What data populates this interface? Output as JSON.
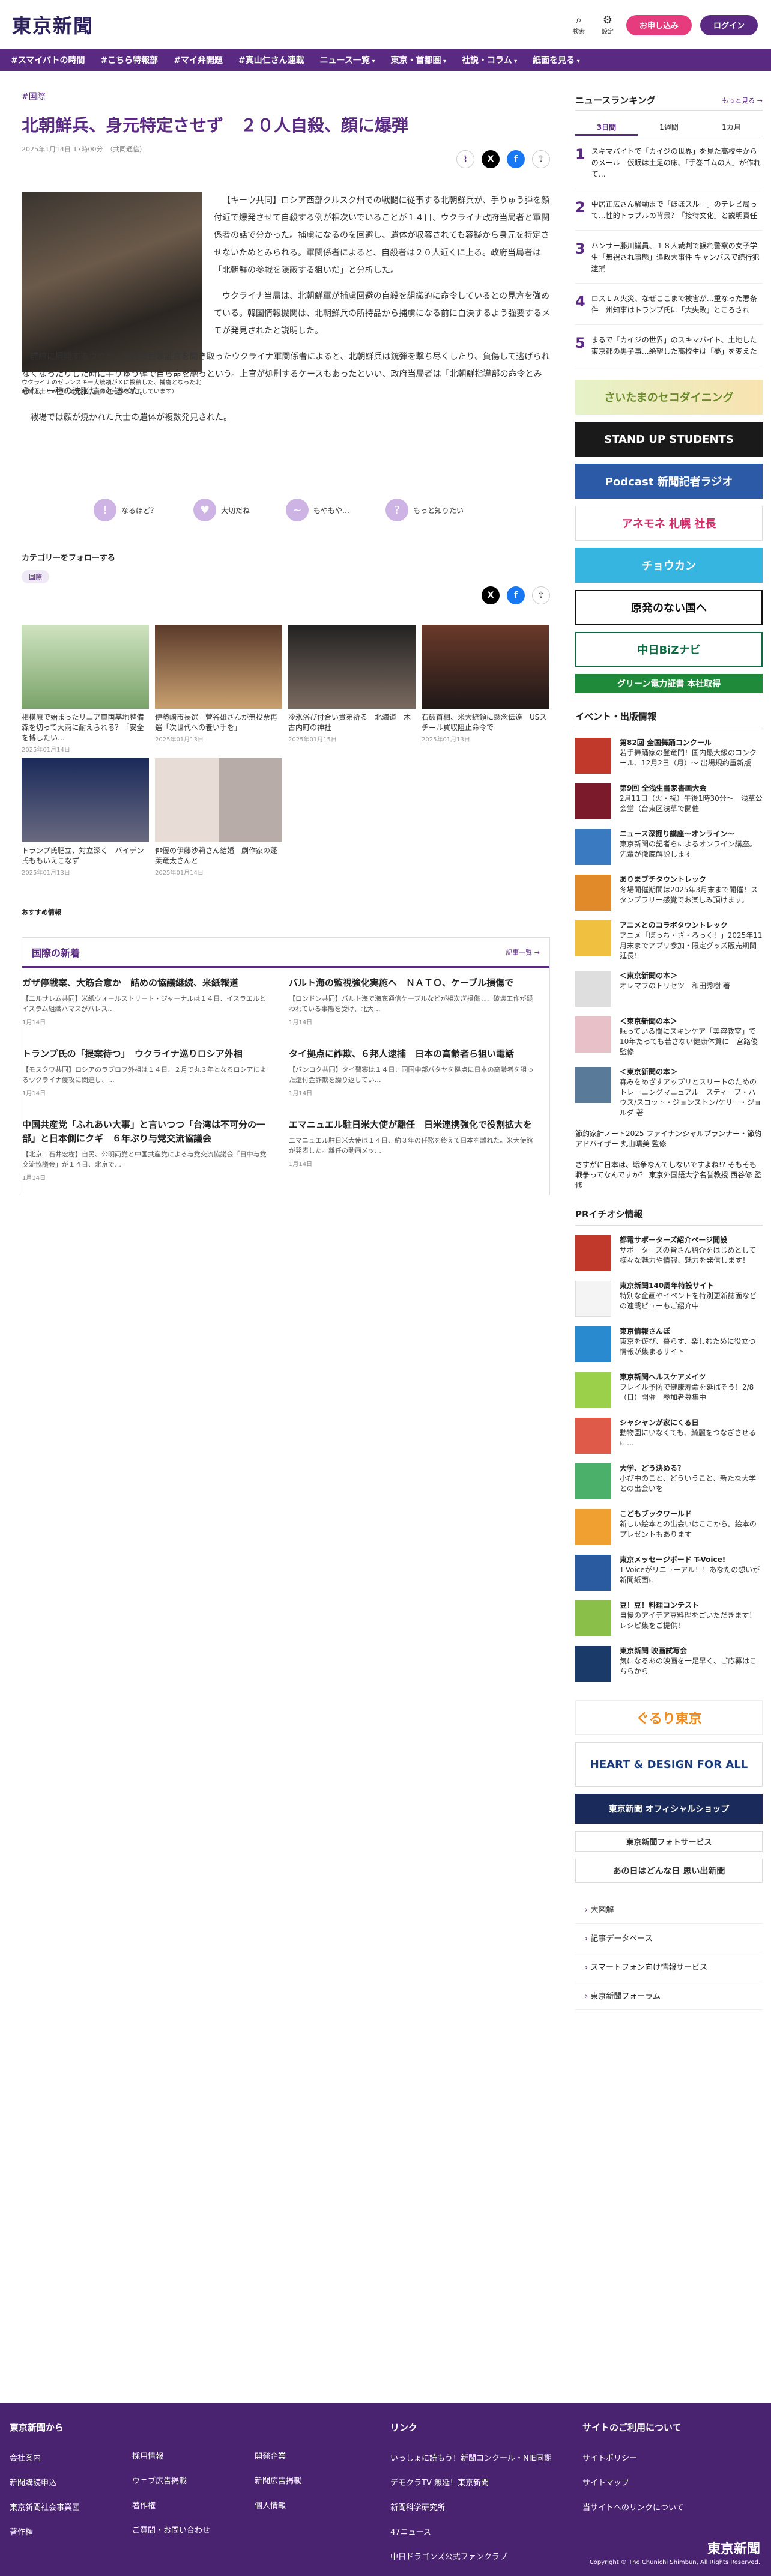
{
  "header": {
    "logo": "東京新聞",
    "search": "検索",
    "settings": "設定",
    "register": "お申し込み",
    "login": "ログイン"
  },
  "nav": [
    {
      "label": "#スマイバトの時間"
    },
    {
      "label": "#こちら特報部"
    },
    {
      "label": "#マイ弁開題"
    },
    {
      "label": "#真山仁さん連載"
    },
    {
      "label": "ニュース一覧"
    },
    {
      "label": "東京・首都圏"
    },
    {
      "label": "社説・コラム"
    },
    {
      "label": "紙面を見る"
    }
  ],
  "article": {
    "tag": "#国際",
    "title": "北朝鮮兵、身元特定させず　２０人自殺、顔に爆弾",
    "date": "2025年1月14日 17時00分　（共同通信）",
    "photo_caption": "ウクライナのゼレンスキー大統領がＸに投稿した、捕虜となった北朝鮮兵士とみられる男性（画像の一部を加工しています）",
    "p1": "【キーウ共同】ロシア西部クルスク州での戦闘に従事する北朝鮮兵が、手りゅう弾を顔付近で爆発させて自殺する例が相次いでいることが１４日、ウクライナ政府当局者と軍関係者の話で分かった。捕虜になるのを回避し、遺体が収容されても容疑から身元を特定させないためとみられる。軍関係者によると、自殺者は２０人近くに上る。政府当局者は「北朝鮮の参戦を隠蔽する狙いだ」と分析した。",
    "p2": "ウクライナ当局は、北朝鮮軍が捕虜回避の自殺を組織的に命令しているとの見方を強めている。韓国情報機関は、北朝鮮兵の所持品から捕虜になる前に自決するよう強要するメモが発見されたと説明した。",
    "p3": "前線に展開するウクライナ兵の目撃証言を聞き取ったウクライナ軍関係者によると、北朝鮮兵は銃弾を撃ち尽くしたり、負傷して逃げられなくなったりした時に手りゅう弾で自ら命を絶っという。上官が処刑するケースもあったといい、政府当局者は「北朝鮮指導部の命令とみられ、一種の洗脳だ」と述べた。",
    "p4": "戦場では顔が焼かれた兵士の遺体が複数発見された。"
  },
  "reactions": [
    "なるほど？",
    "大切だね",
    "もやもや…",
    "もっと知りたい"
  ],
  "follow": {
    "label": "カテゴリーをフォローする",
    "tag": "国際"
  },
  "related": [
    {
      "title": "相模原で始まったリニア車両基地整備　森を切って大雨に耐えられる？「安全を博したい…",
      "date": "2025年01月14日"
    },
    {
      "title": "伊勢崎市長選　菅谷雄さんが無投票再選「次世代への養い手を」",
      "date": "2025年01月13日"
    },
    {
      "title": "冷氷浴び付合い貴弟祈る　北海道　木古内町の神社",
      "date": "2025年01月15日"
    },
    {
      "title": "石破首相、米大統領に懸念伝達　USスチール買収阻止命令で",
      "date": "2025年01月13日"
    },
    {
      "title": "トランプ氏肥立、対立深く　バイデン氏ももいえこなず",
      "date": "2025年01月13日"
    },
    {
      "title": "俳優の伊藤沙莉さん結婚　劇作家の蓬莱竜太さんと",
      "date": "2025年01月14日"
    }
  ],
  "osusume": "おすすめ情報",
  "intl": {
    "title": "国際の新着",
    "more": "記事一覧 →",
    "items": [
      {
        "h": "ガザ停戦案、大筋合意か　詰めの協議継続、米紙報道",
        "s": "【エルサレム共同】米紙ウォールストリート・ジャーナルは１４日、イスラエルとイスラム組織ハマスがパレス…",
        "d": "1月14日"
      },
      {
        "h": "バルト海の監視強化実施へ　ＮＡＴＯ、ケーブル損傷で",
        "s": "【ロンドン共同】バルト海で海底通信ケーブルなどが相次ぎ損傷し、破壊工作が疑われている事態を受け、北大…",
        "d": "1月14日"
      },
      {
        "h": "トランプ氏の「提案待つ」　ウクライナ巡りロシア外相",
        "s": "【モスクワ共同】ロシアのラブロフ外相は１４日、２月で丸３年となるロシアによるウクライナ侵攻に関連し、…",
        "d": "1月14日"
      },
      {
        "h": "タイ拠点に詐欺、６邦人逮捕　日本の高齢者ら狙い電話",
        "s": "【バンコク共同】タイ警察は１４日、同国中部パタヤを拠点に日本の高齢者を狙った還付金詐欺を繰り返してい…",
        "d": "1月14日"
      },
      {
        "h": "中国共産党「ふれあい大事」と言いつつ「台湾は不可分の一部」と日本側にクギ　６年ぶり与党交流協議会",
        "s": "【北京＝石井宏樹】自民、公明両党と中国共産党による与党交流協議会「日中与党交流協議会」が１４日、北京で…",
        "d": "1月14日"
      },
      {
        "h": "エマニュエル駐日米大使が離任　日米連携強化で役割拡大を",
        "s": "エマニュエル駐日米大使は１４日、約３年の任務を終えて日本を離れた。米大使館が発表した。離任の動画メッ…",
        "d": "1月14日"
      }
    ]
  },
  "ranking": {
    "title": "ニュースランキング",
    "more": "もっと見る →",
    "tabs": [
      "3日間",
      "1週間",
      "1カ月"
    ],
    "items": [
      "スキマバイトで「カイジの世界」を見た高校生からのメール　仮眠は土足の床、「手巻ゴムの人」が作れて…",
      "中居正広さん騒動まで「ほぼスルー」のテレビ局って…性的トラブルの背景？「接待文化」と説明責任",
      "ハンサー藤川議員、１８人裁判で誤れ警察の女子学生「無視され事態」追政大事件 キャンパスで続行犯逮捕",
      "ロスＬＡ火災、なぜここまで被害が…重なった悪条件　州知事はトランプ氏に「大失敗」ところされ",
      "まるで「カイジの世界」のスキマバイト、土地した東京都の男子事…絶望した高校生は「夢」を変えた"
    ]
  },
  "banners": [
    "さいたまのセコダイニング",
    "STAND UP STUDENTS",
    "Podcast 新聞記者ラジオ",
    "アネモネ 札幌 社長",
    "チョウカン",
    "原発のない国へ",
    "中日BiZナビ",
    "グリーン電力証書 本社取得"
  ],
  "events": {
    "title": "イベント・出版情報",
    "items": [
      {
        "b": "第82回 全国舞踊コンクール",
        "t": "若手舞踊家の登竜門！国内最大級のコンクール、12月2日（月）～ 出場規約重新版"
      },
      {
        "b": "第9回 全浅生書家書画大会",
        "t": "2月11日（火・祝）午後1時30分～　浅草公会堂（台東区浅草で開催"
      },
      {
        "b": "ニュース深掘り講座〜オンライン〜",
        "t": "東京新聞の記者らによるオンライン講座。先輩が徹底解説します"
      },
      {
        "b": "ありまブチタウントレック",
        "t": "冬場開催期間は2025年3月末まで開催！スタンプラリー感覚でお楽しみ頂けます。"
      },
      {
        "b": "アニメとのコラボタウントレック",
        "t": "アニメ「ぼっち・ざ・ろっく！」2025年11月末までアプリ参加・限定グッズ販売期間延長！"
      },
      {
        "b": "＜東京新聞の本＞",
        "t": "オレマフのトリセツ　和田秀樹 著"
      },
      {
        "b": "＜東京新聞の本＞",
        "t": "眠っている間にスキンケア「美容教室」で10年たっても若さない健康体質に　宮路俊 監修"
      },
      {
        "b": "＜東京新聞の本＞",
        "t": "森みをめざすアップリとスリートのためのトレーニングマニュアル　スティーブ・ハウス/スコット・ジョンストン/ケリー・ジョルダ 著"
      }
    ]
  },
  "links1": [
    "節約家計ノート2025 ファイナンシャルプランナー・節約アドバイザー 丸山晴美 監修",
    "さすがに日本は、戦争なんてしないですよね!? そもそも戦争ってなんですか？ 東京外国語大学名誉教授 西谷修 監修"
  ],
  "pr": {
    "title": "PRイチオシ情報",
    "items": [
      {
        "b": "都電サポーターズ紹介ページ開設",
        "t": "サポーターズの皆さん紹介をはじめとして様々な魅力や情報、魅力を発信します！"
      },
      {
        "b": "東京新聞140周年特設サイト",
        "t": "特別な企画やイベントを特別更新誌面などの連載ビューもご紹介中"
      },
      {
        "b": "東京情報さんぽ",
        "t": "東京を遊び、暮らす、楽しむために役立つ情報が集まるサイト"
      },
      {
        "b": "東京新聞ヘルスケアメイツ",
        "t": "フレイル予防で健康寿命を延ばそう！2/8（日）開催　参加者募集中"
      },
      {
        "b": "シャシャンが家にくる日",
        "t": "動物園にいなくても、綺麗をつなぎさせるに…"
      },
      {
        "b": "大学、どう決める？",
        "t": "小び中のこと、どういうこと、新たな大学との出会いを"
      },
      {
        "b": "こどもブックワールド",
        "t": "新しい絵本との出会いはここから。絵本のプレゼントもあります"
      },
      {
        "b": "東京メッセージボード T-Voice!",
        "t": "T-Voiceがリニューアル！！あなたの想いが新聞紙面に"
      },
      {
        "b": "豆！豆！料理コンテスト",
        "t": "自慢のアイデア豆料理をごいただきます！レシピ集をご提供！"
      },
      {
        "b": "東京新聞 映画試写会",
        "t": "気になるあの映画を一足早く、ご応募はこちらから"
      }
    ]
  },
  "sidebanners": [
    "ぐるり東京",
    "HEART & DESIGN FOR ALL",
    "東京新聞 オフィシャルショップ",
    "東京新聞フォトサービス",
    "あの日はどんな日 思い出新聞"
  ],
  "sidelinks": [
    "大図解",
    "記事データベース",
    "スマートフォン向け情報サービス",
    "東京新聞フォーラム"
  ],
  "footer": {
    "col1": {
      "title": "東京新聞から",
      "items": [
        "会社案内",
        "新聞購読申込",
        "東京新聞社会事業団",
        "著作権",
        "採用情報",
        "ウェブ広告掲載",
        "著作権",
        "ご質問・お問い合わせ",
        "開発企業",
        "新聞広告掲載",
        "個人情報"
      ]
    },
    "col2": {
      "title": "リンク",
      "items": [
        "いっしょに読もう！新聞コンクール・NIE同期",
        "デモクラTV 無延！東京新聞",
        "新聞科学研究所",
        "47ニュース",
        "中日ドラゴンズ公式ファンクラブ"
      ]
    },
    "col3": {
      "title": "サイトのご利用について",
      "items": [
        "サイトポリシー",
        "サイトマップ",
        "当サイトへのリンクについて"
      ]
    },
    "logo": "東京新聞",
    "copyright": "Copyright © The Chunichi Shimbun, All Rights Reserved."
  }
}
